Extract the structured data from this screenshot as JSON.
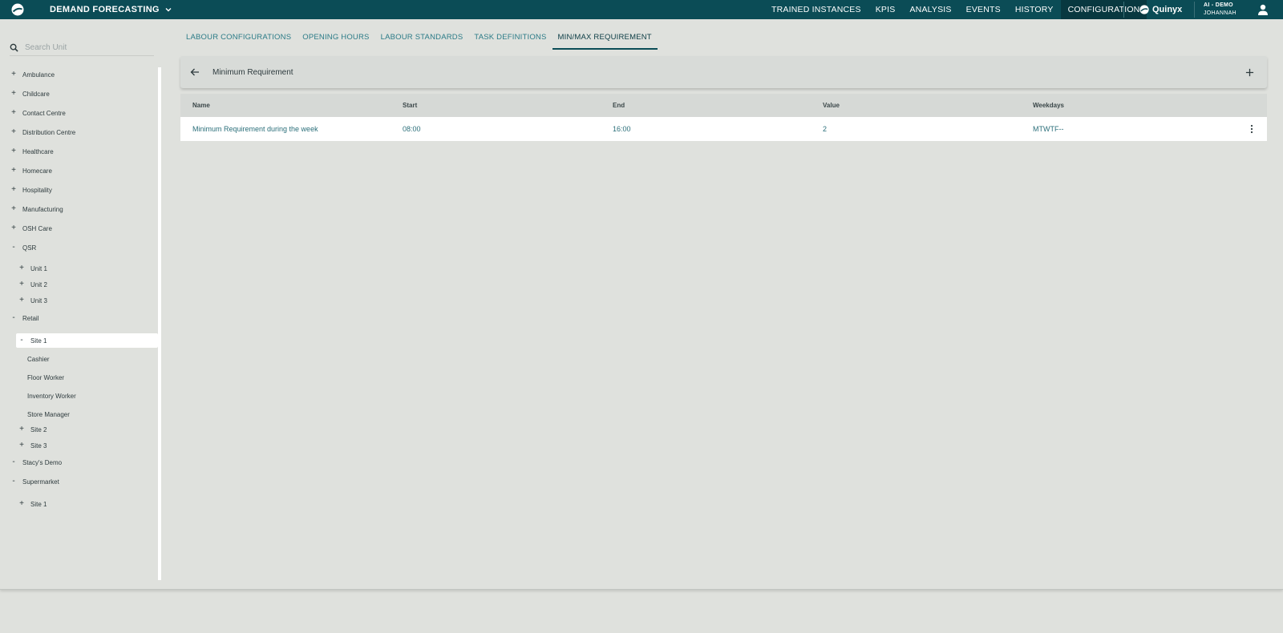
{
  "header": {
    "app_title": "DEMAND FORECASTING",
    "nav": [
      {
        "label": "TRAINED INSTANCES",
        "active": false
      },
      {
        "label": "KPIS",
        "active": false
      },
      {
        "label": "ANALYSIS",
        "active": false
      },
      {
        "label": "EVENTS",
        "active": false
      },
      {
        "label": "HISTORY",
        "active": false
      },
      {
        "label": "CONFIGURATION",
        "active": true
      }
    ],
    "brand": "Quinyx",
    "user_org": "AI - DEMO",
    "user_name": "JOHANNAH"
  },
  "sidebar": {
    "search_placeholder": "Search Unit",
    "tree": [
      {
        "label": "Ambulance",
        "toggle": "+",
        "level": 0
      },
      {
        "label": "Childcare",
        "toggle": "+",
        "level": 0
      },
      {
        "label": "Contact Centre",
        "toggle": "+",
        "level": 0
      },
      {
        "label": "Distribution Centre",
        "toggle": "+",
        "level": 0
      },
      {
        "label": "Healthcare",
        "toggle": "+",
        "level": 0
      },
      {
        "label": "Homecare",
        "toggle": "+",
        "level": 0
      },
      {
        "label": "Hospitality",
        "toggle": "+",
        "level": 0
      },
      {
        "label": "Manufacturing",
        "toggle": "+",
        "level": 0
      },
      {
        "label": "OSH Care",
        "toggle": "+",
        "level": 0
      },
      {
        "label": "QSR",
        "toggle": "-",
        "level": 0
      },
      {
        "label": "Unit 1",
        "toggle": "+",
        "level": 1
      },
      {
        "label": "Unit 2",
        "toggle": "+",
        "level": 1
      },
      {
        "label": "Unit 3",
        "toggle": "+",
        "level": 1
      },
      {
        "label": "Retail",
        "toggle": "-",
        "level": 0
      },
      {
        "label": "Site 1",
        "toggle": "-",
        "level": 1,
        "selected": true
      },
      {
        "label": "Cashier",
        "toggle": "",
        "level": 2
      },
      {
        "label": "Floor Worker",
        "toggle": "",
        "level": 2
      },
      {
        "label": "Inventory Worker",
        "toggle": "",
        "level": 2
      },
      {
        "label": "Store Manager",
        "toggle": "",
        "level": 2
      },
      {
        "label": "Site 2",
        "toggle": "+",
        "level": 1
      },
      {
        "label": "Site 3",
        "toggle": "+",
        "level": 1
      },
      {
        "label": "Stacy's Demo",
        "toggle": "-",
        "level": 0
      },
      {
        "label": "Supermarket",
        "toggle": "-",
        "level": 0
      },
      {
        "label": "Site 1",
        "toggle": "+",
        "level": 1
      }
    ]
  },
  "tabs": [
    {
      "label": "LABOUR CONFIGURATIONS",
      "active": false
    },
    {
      "label": "OPENING HOURS",
      "active": false
    },
    {
      "label": "LABOUR STANDARDS",
      "active": false
    },
    {
      "label": "TASK DEFINITIONS",
      "active": false
    },
    {
      "label": "MIN/MAX REQUIREMENT",
      "active": true
    }
  ],
  "panel": {
    "title": "Minimum Requirement"
  },
  "table": {
    "columns": [
      "Name",
      "Start",
      "End",
      "Value",
      "Weekdays"
    ],
    "rows": [
      [
        "Minimum Requirement during the week",
        "08:00",
        "16:00",
        "2",
        "MTWTF--"
      ]
    ]
  },
  "colors": {
    "topbar": "#0b4c56",
    "accent_text": "#2b7b87",
    "background": "#dfe1dd"
  }
}
